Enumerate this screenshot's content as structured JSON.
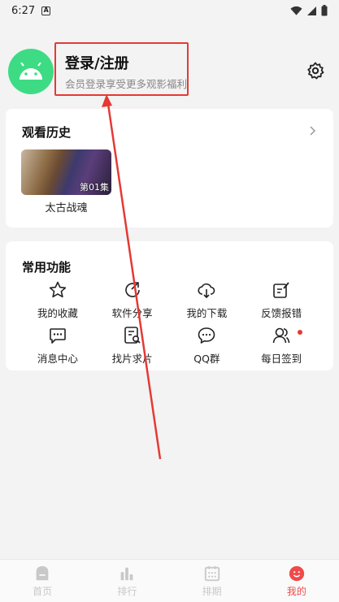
{
  "status_bar": {
    "time": "6:27"
  },
  "profile": {
    "title": "登录/注册",
    "subtitle": "会员登录享受更多观影福利"
  },
  "history": {
    "title": "观看历史",
    "items": [
      {
        "name": "太古战魂",
        "episode": "第01集"
      }
    ]
  },
  "features": {
    "title": "常用功能",
    "items": [
      {
        "label": "我的收藏",
        "icon": "star-icon"
      },
      {
        "label": "软件分享",
        "icon": "share-icon"
      },
      {
        "label": "我的下载",
        "icon": "cloud-download-icon"
      },
      {
        "label": "反馈报错",
        "icon": "feedback-icon"
      },
      {
        "label": "消息中心",
        "icon": "message-icon"
      },
      {
        "label": "找片求片",
        "icon": "search-doc-icon"
      },
      {
        "label": "QQ群",
        "icon": "chat-icon"
      },
      {
        "label": "每日签到",
        "icon": "users-icon"
      }
    ]
  },
  "tabbar": {
    "items": [
      {
        "label": "首页",
        "icon": "home-icon"
      },
      {
        "label": "排行",
        "icon": "rank-icon"
      },
      {
        "label": "排期",
        "icon": "calendar-icon"
      },
      {
        "label": "我的",
        "icon": "me-icon"
      }
    ],
    "active_index": 3
  },
  "colors": {
    "accent": "#f04a4a",
    "annotation": "#e53935",
    "avatar": "#3ddc84"
  }
}
